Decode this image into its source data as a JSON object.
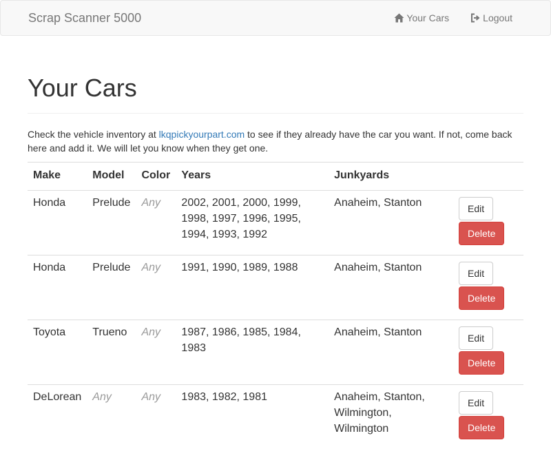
{
  "navbar": {
    "brand": "Scrap Scanner 5000",
    "links": [
      {
        "label": "Your Cars",
        "icon": "home-icon"
      },
      {
        "label": "Logout",
        "icon": "logout-icon"
      }
    ]
  },
  "page": {
    "title": "Your Cars",
    "intro_before": "Check the vehicle inventory at ",
    "intro_link": "lkqpickyourpart.com",
    "intro_after": " to see if they already have the car you want. If not, come back here and add it. We will let you know when they get one."
  },
  "table": {
    "headers": {
      "make": "Make",
      "model": "Model",
      "color": "Color",
      "years": "Years",
      "junkyards": "Junkyards"
    },
    "edit_label": "Edit",
    "delete_label": "Delete",
    "rows": [
      {
        "make": "Honda",
        "model": "Prelude",
        "color": "Any",
        "years": "2002, 2001, 2000, 1999, 1998, 1997, 1996, 1995, 1994, 1993, 1992",
        "junkyards": "Anaheim, Stanton"
      },
      {
        "make": "Honda",
        "model": "Prelude",
        "color": "Any",
        "years": "1991, 1990, 1989, 1988",
        "junkyards": "Anaheim, Stanton"
      },
      {
        "make": "Toyota",
        "model": "Trueno",
        "color": "Any",
        "years": "1987, 1986, 1985, 1984, 1983",
        "junkyards": "Anaheim, Stanton"
      },
      {
        "make": "DeLorean",
        "model": "Any",
        "color": "Any",
        "years": "1983, 1982, 1981",
        "junkyards": "Anaheim, Stanton, Wilmington, Wilmington"
      }
    ]
  }
}
